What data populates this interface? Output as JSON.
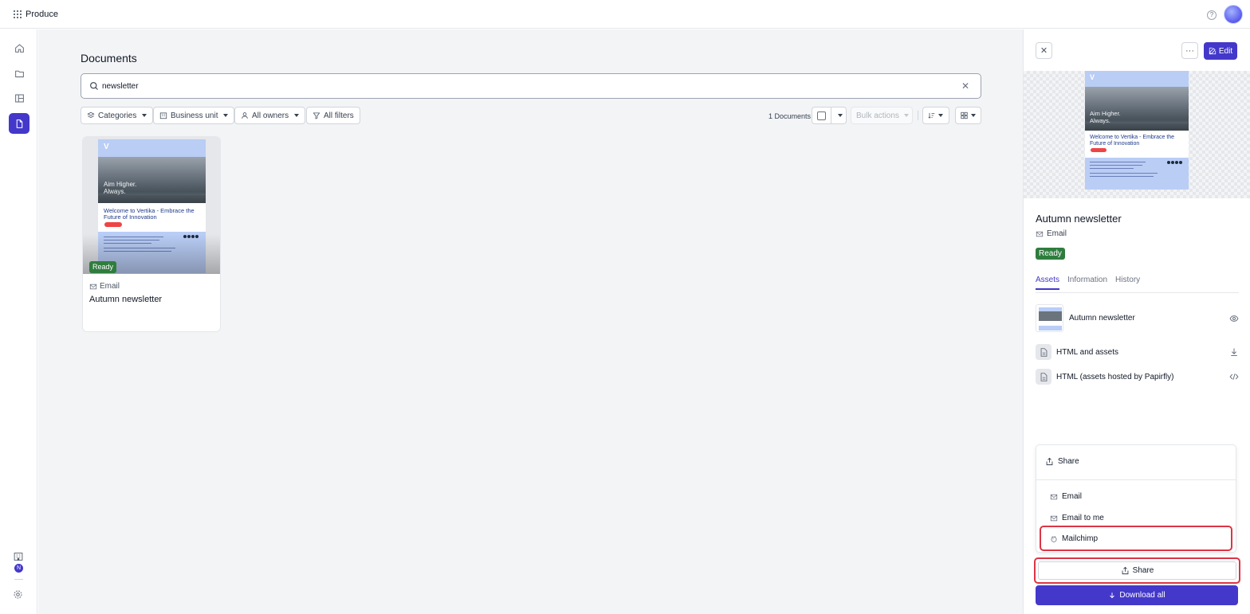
{
  "app": {
    "name": "Produce"
  },
  "header": {
    "help_icon": "question-circle-icon",
    "avatar": "user-avatar"
  },
  "sidebar": {
    "items": [
      {
        "name": "home",
        "icon": "home-icon"
      },
      {
        "name": "folders",
        "icon": "folder-icon"
      },
      {
        "name": "templates",
        "icon": "layout-icon"
      },
      {
        "name": "documents",
        "icon": "document-icon",
        "active": true
      }
    ],
    "workspace_badge": "N"
  },
  "main": {
    "title": "Documents",
    "search": {
      "value": "newsletter",
      "placeholder": ""
    },
    "filters": {
      "categories": "Categories",
      "business_unit": "Business unit",
      "all_owners": "All owners",
      "all_filters": "All filters"
    },
    "doc_count": "1 Documents",
    "bulk_actions": "Bulk actions",
    "cards": [
      {
        "type": "Email",
        "name": "Autumn newsletter",
        "status": "Ready"
      }
    ]
  },
  "newsletter": {
    "tagline_1": "Aim Higher.",
    "tagline_2": "Always.",
    "heading": "Welcome to Vertika - Embrace the Future of Innovation"
  },
  "panel": {
    "edit_label": "Edit",
    "title": "Autumn newsletter",
    "type": "Email",
    "status": "Ready",
    "tabs": [
      "Assets",
      "Information",
      "History"
    ],
    "assets": [
      {
        "label": "Autumn newsletter",
        "action_icon": "eye-icon"
      },
      {
        "label": "HTML and assets",
        "action_icon": "download-icon"
      },
      {
        "label": "HTML (assets hosted by Papirfly)",
        "action_icon": "code-icon"
      }
    ],
    "share_menu": {
      "title": "Share",
      "items": [
        "Email",
        "Email to me",
        "Mailchimp"
      ]
    },
    "share_label": "Share",
    "download_all_label": "Download all"
  },
  "colors": {
    "primary": "#4338ca",
    "ready": "#2f7d3e",
    "highlight": "#dc3545"
  }
}
